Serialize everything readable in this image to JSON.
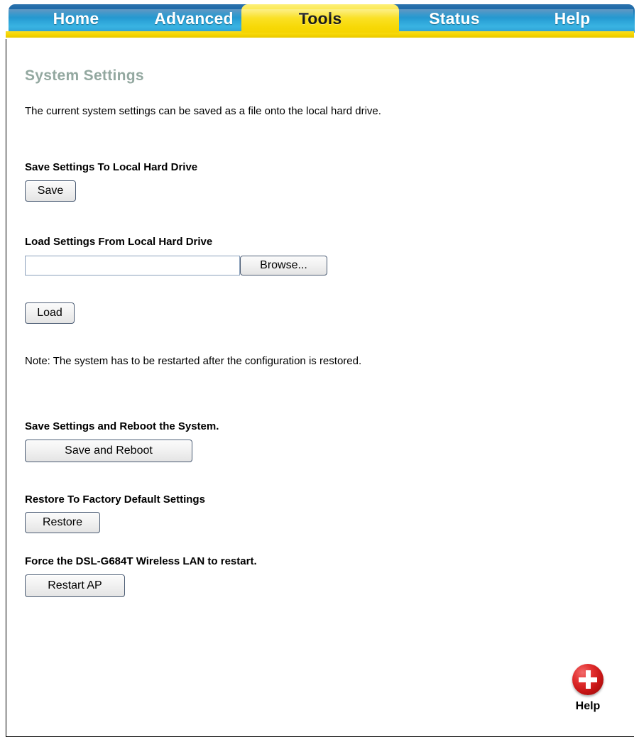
{
  "nav": {
    "tabs": [
      {
        "label": "Home",
        "active": false
      },
      {
        "label": "Advanced",
        "active": false
      },
      {
        "label": "Tools",
        "active": true
      },
      {
        "label": "Status",
        "active": false
      },
      {
        "label": "Help",
        "active": false
      }
    ],
    "active_color": "#f5d400",
    "inactive_color": "#2ca3d8"
  },
  "page": {
    "title": "System Settings",
    "title_color": "#93a8a0",
    "intro": "The current system settings can be saved as a file onto the local hard drive."
  },
  "sections": {
    "save": {
      "label": "Save Settings To Local Hard Drive",
      "button": "Save"
    },
    "load": {
      "label": "Load Settings From Local Hard Drive",
      "input_value": "",
      "input_placeholder": "",
      "browse_button": "Browse...",
      "button": "Load",
      "note": "Note: The system has to be restarted after the configuration is restored."
    },
    "reboot": {
      "label": "Save Settings and Reboot the System.",
      "button": "Save and Reboot"
    },
    "restore": {
      "label": "Restore To Factory Default Settings",
      "button": "Restore"
    },
    "restart_ap": {
      "label": "Force the DSL-G684T Wireless LAN to restart.",
      "button": "Restart AP"
    }
  },
  "help": {
    "label": "Help",
    "icon": "help-plus-icon",
    "icon_color": "#c61414"
  }
}
